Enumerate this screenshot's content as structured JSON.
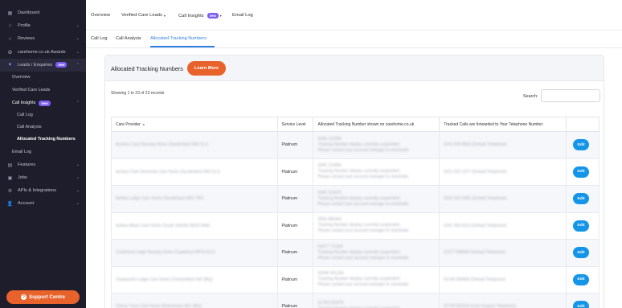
{
  "sidebar": {
    "items": [
      {
        "label": "Dashboard",
        "icon": "dashboard-icon",
        "chevron": ""
      },
      {
        "label": "Profile",
        "icon": "home-icon",
        "chevron": "⌄"
      },
      {
        "label": "Reviews",
        "icon": "star-icon",
        "chevron": "⌄"
      },
      {
        "label": "carehome.co.uk Awards",
        "icon": "award-icon",
        "chevron": "⌄"
      },
      {
        "label": "Leads / Enquiries",
        "icon": "funnel-icon",
        "chevron": "⌃",
        "badge": "new"
      },
      {
        "label": "Features",
        "icon": "features-icon",
        "chevron": "⌄"
      },
      {
        "label": "Jobs",
        "icon": "briefcase-icon",
        "chevron": "⌄"
      },
      {
        "label": "APIs & Integrations",
        "icon": "api-icon",
        "chevron": "⌄"
      },
      {
        "label": "Account",
        "icon": "account-icon",
        "chevron": "⌄"
      }
    ],
    "leads_sub": [
      {
        "label": "Overview"
      },
      {
        "label": "Verified Care Leads"
      },
      {
        "label": "Call Insights",
        "badge": "new",
        "chevron": "⌃"
      },
      {
        "label": "Call Log"
      },
      {
        "label": "Call Analysis"
      },
      {
        "label": "Allocated Tracking Numbers"
      },
      {
        "label": "Email Log"
      }
    ],
    "support_label": "Support Centre"
  },
  "topnav": {
    "items": [
      {
        "label": "Overview"
      },
      {
        "label": "Verified Care Leads",
        "caret": "▾"
      },
      {
        "label": "Call Insights",
        "badge": "new",
        "caret": "▾"
      },
      {
        "label": "Email Log"
      }
    ]
  },
  "subnav": {
    "tabs": [
      "Call Log",
      "Call Analysis",
      "Allocated Tracking Numbers"
    ],
    "active": "Allocated Tracking Numbers"
  },
  "panel": {
    "title": "Allocated Tracking Numbers",
    "learn_more": "Learn More",
    "showing": "Showing 1 to 23 of 23 records",
    "search_label": "Search:",
    "search_value": ""
  },
  "table": {
    "headers": [
      "Care Provider",
      "Service Level",
      "Allocated Tracking Number shown on carehome.co.uk",
      "Tracked Calls are forwarded to Your Telephone Number",
      ""
    ],
    "edit_label": "Edit",
    "rows": [
      {
        "provider": "Archers Court Nursing Home (Sunderland SR3 3LJ)",
        "level": "Platinum",
        "tracking": [
          "0345 123456",
          "Tracking Number display currently suspended",
          "Please contact your account manager to reactivate."
        ],
        "forward": "0191 528 3500 (Default Telephone)"
      },
      {
        "provider": "Archers Park Dementia Care Home (Sunderland SR3 3LJ)",
        "level": "Platinum",
        "tracking": [
          "0345 123456",
          "Tracking Number display currently suspended",
          "Please contact your account manager to reactivate."
        ],
        "forward": "0191 522 1377 (Default Telephone)"
      },
      {
        "provider": "Ashlea Lodge Care Home (Sunderland SR4 7AY)",
        "level": "Platinum",
        "tracking": [
          "0345 123470",
          "Tracking Number display currently suspended",
          "Please contact your account manager to reactivate."
        ],
        "forward": "0191 510 1465 (Default Telephone)"
      },
      {
        "provider": "Ashlea Mews Care Home (South Shields NE33 4NA)",
        "level": "Platinum",
        "tracking": [
          "0354 485464",
          "Tracking Number display currently suspended",
          "Please contact your account manager to reactivate."
        ],
        "forward": "0191 455 6113 (Default Telephone)"
      },
      {
        "provider": "Castleford Lodge Nursing Home (Castleford WF10 5LY)",
        "level": "Platinum",
        "tracking": [
          "03477 711164",
          "Tracking Number display currently suspended",
          "Please contact your account manager to reactivate."
        ],
        "forward": "01977 668465 (Default Telephone)"
      },
      {
        "provider": "Chatsworth Lodge Care Home (Chesterfield S40 3BQ)",
        "level": "Platinum",
        "tracking": [
          "03346 441234",
          "Tracking Number display currently suspended",
          "Please contact your account manager to reactivate."
        ],
        "forward": "01246 550005 (Default Telephone)"
      },
      {
        "provider": "Cherry Trees Care Home (Rotherham S61 3BQ)",
        "level": "Platinum",
        "tracking": [
          "01709 315479",
          "Tracking Number display currently suspended",
          ""
        ],
        "forward": "01709 553123 (Care Enquiry Telephone)"
      }
    ]
  },
  "colors": {
    "sidebar_bg": "#1d1d2b",
    "accent_orange": "#e8622c",
    "badge_purple": "#7b5cf5",
    "edit_blue": "#1495e8",
    "link_blue": "#2f7de1"
  }
}
